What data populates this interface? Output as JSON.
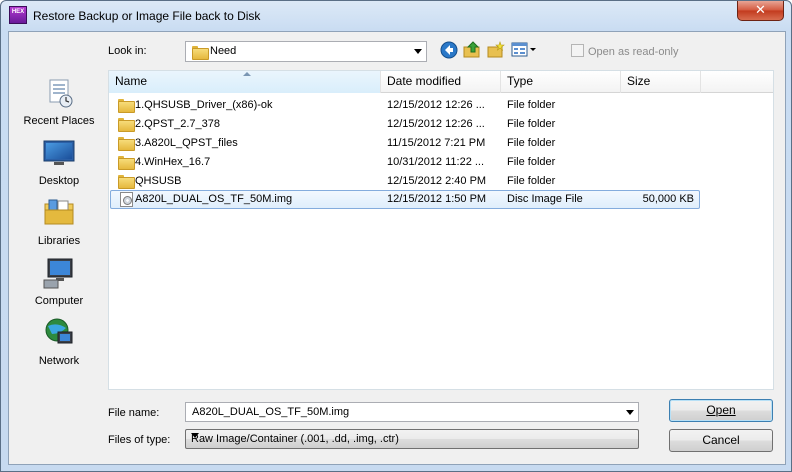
{
  "window": {
    "title": "Restore Backup or Image File back to Disk",
    "app_icon_text": "HEX",
    "close_symbol": "✕"
  },
  "toolbar": {
    "look_in_label": "Look in:",
    "look_in_value": "Need",
    "icons": [
      "back-icon",
      "up-folder-icon",
      "new-folder-icon",
      "view-menu-icon"
    ],
    "read_only_label": "Open as read-only"
  },
  "places": [
    {
      "label": "Recent Places",
      "icon": "recent-places-icon"
    },
    {
      "label": "Desktop",
      "icon": "desktop-icon"
    },
    {
      "label": "Libraries",
      "icon": "libraries-icon"
    },
    {
      "label": "Computer",
      "icon": "computer-icon"
    },
    {
      "label": "Network",
      "icon": "network-icon"
    }
  ],
  "columns": {
    "name": "Name",
    "date": "Date modified",
    "type": "Type",
    "size": "Size"
  },
  "files": [
    {
      "name": "1.QHSUSB_Driver_(x86)-ok",
      "date": "12/15/2012 12:26 ...",
      "type": "File folder",
      "size": "",
      "icon": "folder-icon"
    },
    {
      "name": "2.QPST_2.7_378",
      "date": "12/15/2012 12:26 ...",
      "type": "File folder",
      "size": "",
      "icon": "folder-icon"
    },
    {
      "name": "3.A820L_QPST_files",
      "date": "11/15/2012 7:21 PM",
      "type": "File folder",
      "size": "",
      "icon": "folder-icon"
    },
    {
      "name": "4.WinHex_16.7",
      "date": "10/31/2012 11:22 ...",
      "type": "File folder",
      "size": "",
      "icon": "folder-icon"
    },
    {
      "name": "QHSUSB",
      "date": "12/15/2012 2:40 PM",
      "type": "File folder",
      "size": "",
      "icon": "folder-icon"
    },
    {
      "name": "A820L_DUAL_OS_TF_50M.img",
      "date": "12/15/2012 1:50 PM",
      "type": "Disc Image File",
      "size": "50,000 KB",
      "icon": "disc-image-icon"
    }
  ],
  "footer": {
    "file_name_label": "File name:",
    "file_name_value": "A820L_DUAL_OS_TF_50M.img",
    "file_type_label": "Files of type:",
    "file_type_value": "Raw Image/Container (.001, .dd, .img, .ctr)",
    "open_label": "Open",
    "cancel_label": "Cancel"
  }
}
